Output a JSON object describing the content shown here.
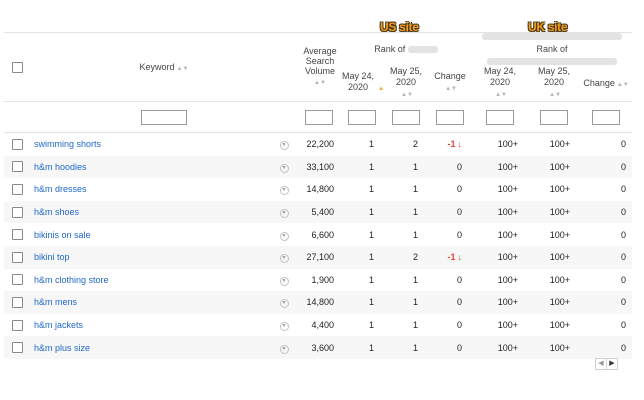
{
  "annotations": {
    "us": "US site",
    "uk": "UK site"
  },
  "header": {
    "keyword": "Keyword",
    "avg_search": "Average Search Volume",
    "rank_of": "Rank of",
    "may24": "May 24, 2020",
    "may25": "May 25, 2020",
    "change": "Change"
  },
  "rows": [
    {
      "keyword": "swimming shorts",
      "volume": "22,200",
      "us_24": "1",
      "us_25": "2",
      "us_change": "-1",
      "uk_24": "100+",
      "uk_25": "100+",
      "uk_change": "0"
    },
    {
      "keyword": "h&m hoodies",
      "volume": "33,100",
      "us_24": "1",
      "us_25": "1",
      "us_change": "0",
      "uk_24": "100+",
      "uk_25": "100+",
      "uk_change": "0"
    },
    {
      "keyword": "h&m dresses",
      "volume": "14,800",
      "us_24": "1",
      "us_25": "1",
      "us_change": "0",
      "uk_24": "100+",
      "uk_25": "100+",
      "uk_change": "0"
    },
    {
      "keyword": "h&m shoes",
      "volume": "5,400",
      "us_24": "1",
      "us_25": "1",
      "us_change": "0",
      "uk_24": "100+",
      "uk_25": "100+",
      "uk_change": "0"
    },
    {
      "keyword": "bikinis on sale",
      "volume": "6,600",
      "us_24": "1",
      "us_25": "1",
      "us_change": "0",
      "uk_24": "100+",
      "uk_25": "100+",
      "uk_change": "0"
    },
    {
      "keyword": "bikini top",
      "volume": "27,100",
      "us_24": "1",
      "us_25": "2",
      "us_change": "-1",
      "uk_24": "100+",
      "uk_25": "100+",
      "uk_change": "0"
    },
    {
      "keyword": "h&m clothing store",
      "volume": "1,900",
      "us_24": "1",
      "us_25": "1",
      "us_change": "0",
      "uk_24": "100+",
      "uk_25": "100+",
      "uk_change": "0"
    },
    {
      "keyword": "h&m mens",
      "volume": "14,800",
      "us_24": "1",
      "us_25": "1",
      "us_change": "0",
      "uk_24": "100+",
      "uk_25": "100+",
      "uk_change": "0"
    },
    {
      "keyword": "h&m jackets",
      "volume": "4,400",
      "us_24": "1",
      "us_25": "1",
      "us_change": "0",
      "uk_24": "100+",
      "uk_25": "100+",
      "uk_change": "0"
    },
    {
      "keyword": "h&m plus size",
      "volume": "3,600",
      "us_24": "1",
      "us_25": "1",
      "us_change": "0",
      "uk_24": "100+",
      "uk_25": "100+",
      "uk_change": "0"
    }
  ],
  "icons": {
    "sort": "sort-arrows-icon",
    "sort_active": "sort-up-icon",
    "dropdown": "chevron-down-circle-icon",
    "down": "arrow-down-icon",
    "prev": "chevron-left-icon",
    "next": "chevron-right-icon"
  },
  "colors": {
    "link": "#1f68c8",
    "negative": "#e0482a",
    "annotation": "#f29b1d",
    "sort_active": "#f5a623"
  }
}
